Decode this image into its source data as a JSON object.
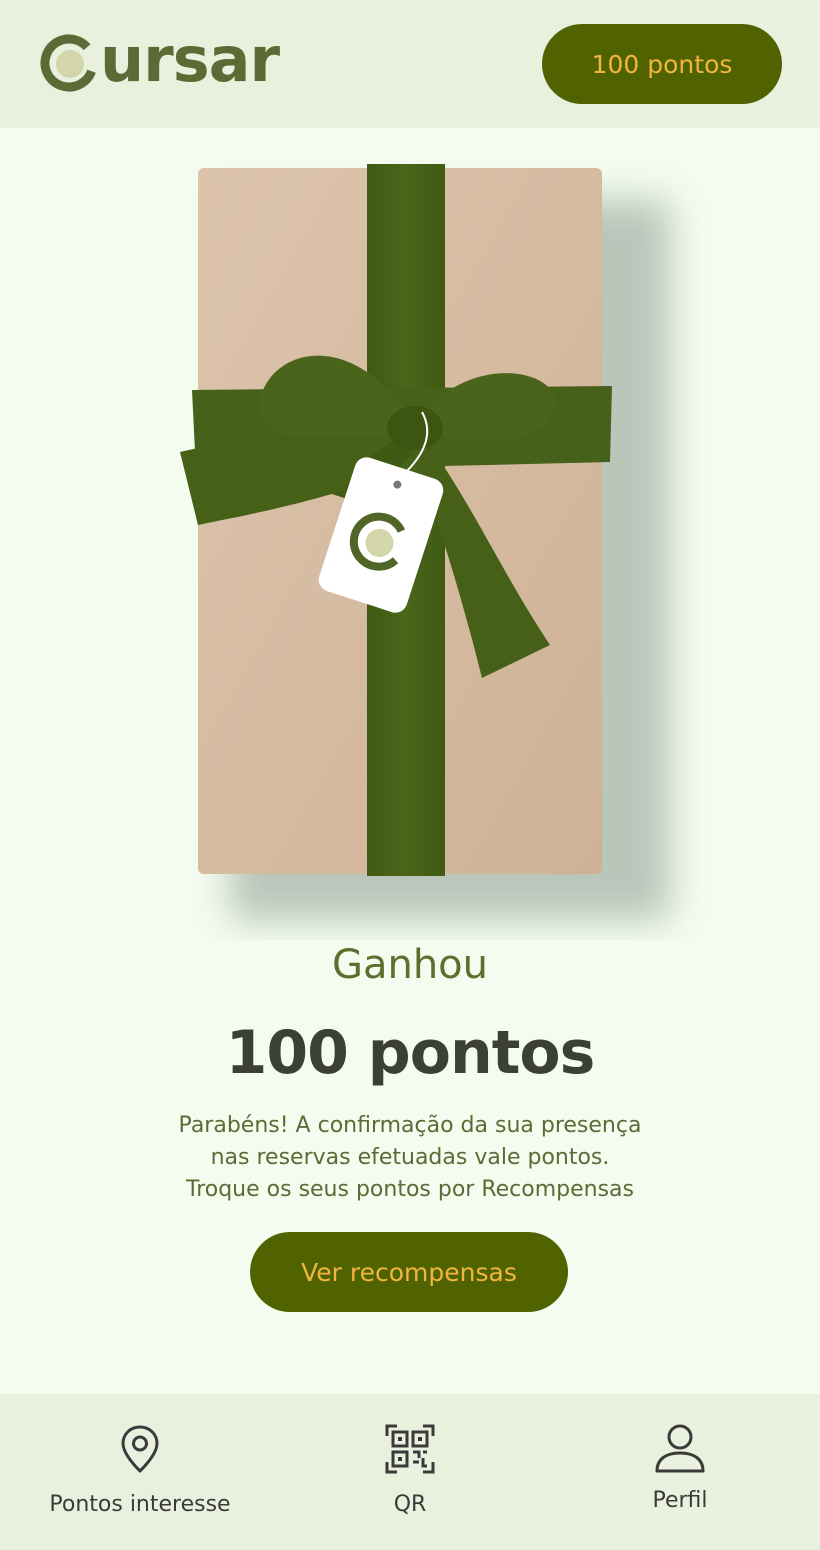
{
  "header": {
    "logo_text": "ursar",
    "logo_full": "cursar",
    "points_badge": "100 pontos"
  },
  "reward": {
    "won_label": "Ganhou",
    "points": "100 pontos",
    "message_lines": [
      "Parabéns! A confirmação da sua presença",
      "nas reservas efetuadas vale pontos.",
      "Troque os seus pontos por Recompensas"
    ],
    "cta_label": "Ver recompensas"
  },
  "bottom_nav": {
    "items": [
      {
        "label": "Pontos interesse",
        "icon": "map-pin-icon"
      },
      {
        "label": "QR",
        "icon": "qr-code-icon"
      },
      {
        "label": "Perfil",
        "icon": "user-icon"
      }
    ]
  },
  "colors": {
    "brand_dark": "#516300",
    "brand_accent": "#f0b53e",
    "logo_green": "#5a6b35",
    "header_bg": "#e9f1de",
    "page_bg": "#f3fcee",
    "ribbon_green": "#466017",
    "box_kraft": "#d9bfa5"
  }
}
